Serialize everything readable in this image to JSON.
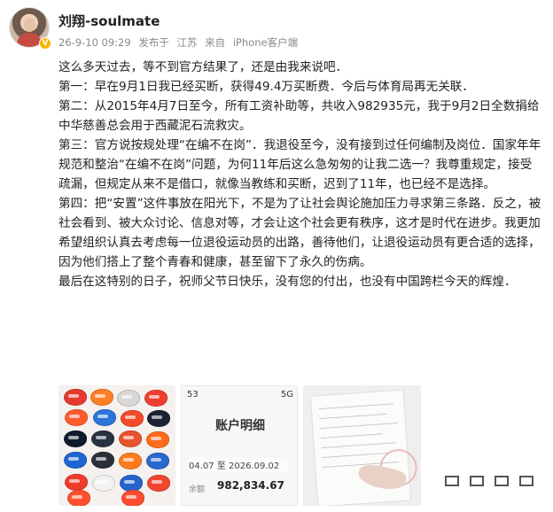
{
  "header": {
    "username": "刘翔-soulmate",
    "date": "26-9-10 09:29",
    "published_in_label": "发布于",
    "location": "江苏",
    "source_label": "来自",
    "client": "iPhone客户端"
  },
  "post": {
    "paragraphs": [
      "这么多天过去，等不到官方结果了，还是由我来说吧．",
      "第一：早在9月1日我已经买断，获得49.4万买断费．今后与体育局再无关联．",
      "第二：从2015年4月7日至今，所有工资补助等，共收入982935元，我于9月2日全数捐给中华慈善总会用于西藏泥石流救灾。",
      "第三：官方说按规处理“在编不在岗”．我退役至今，没有接到过任何编制及岗位．国家年年规范和整治“在编不在岗”问题，为何11年后这么急匆匆的让我二选一？我尊重规定，接受疏漏，但规定从来不是借口，就像当教练和买断，迟到了11年，也已经不是选择。",
      "第四：把“安置”这件事放在阳光下，不是为了让社会舆论施加压力寻求第三条路．反之，被社会看到、被大众讨论、信息对等，才会让这个社会更有秩序，这才是时代在进步。我更加希望组织认真去考虑每一位退役运动员的出路，善待他们，让退役运动员有更合适的选择，因为他们搭上了整个青春和健康，甚至留下了永久的伤病。",
      "最后在这特别的日子，祝师父节日快乐，没有您的付出，也没有中国跨栏今天的辉煌．"
    ]
  },
  "images": {
    "bank_statement": {
      "status_left": "53",
      "status_right": "5G",
      "title": "账户明细",
      "date_range": "04.07 至 2026.09.02",
      "balance_label": "余额",
      "balance": "982,834.67"
    }
  },
  "actions": {
    "icons": [
      "share-icon",
      "comment-icon",
      "like-icon",
      "more-icon"
    ]
  },
  "colors": {
    "meta": "#8a8a8a",
    "verified": "#f8b400"
  }
}
